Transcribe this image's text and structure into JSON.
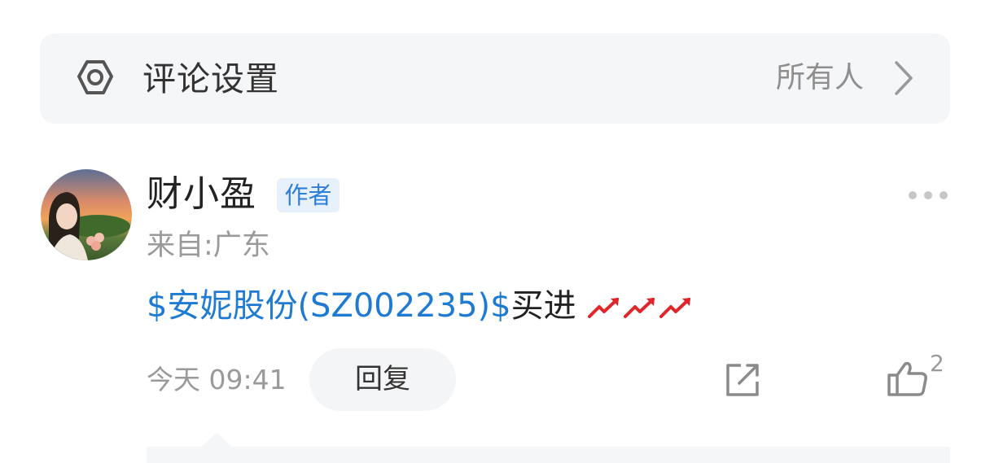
{
  "settings": {
    "title": "评论设置",
    "value": "所有人",
    "icon": "gear-icon"
  },
  "comment": {
    "author": "财小盈",
    "badge": "作者",
    "location": "来自:广东",
    "stock_link": "$安妮股份(SZ002235)$",
    "text": "买进",
    "time": "今天 09:41",
    "reply_label": "回复",
    "like_count": "2"
  },
  "colors": {
    "link": "#1e7ad2",
    "badge_bg": "#e6f1fb",
    "badge_text": "#2f7ed8",
    "trend_red": "#e0262b"
  }
}
